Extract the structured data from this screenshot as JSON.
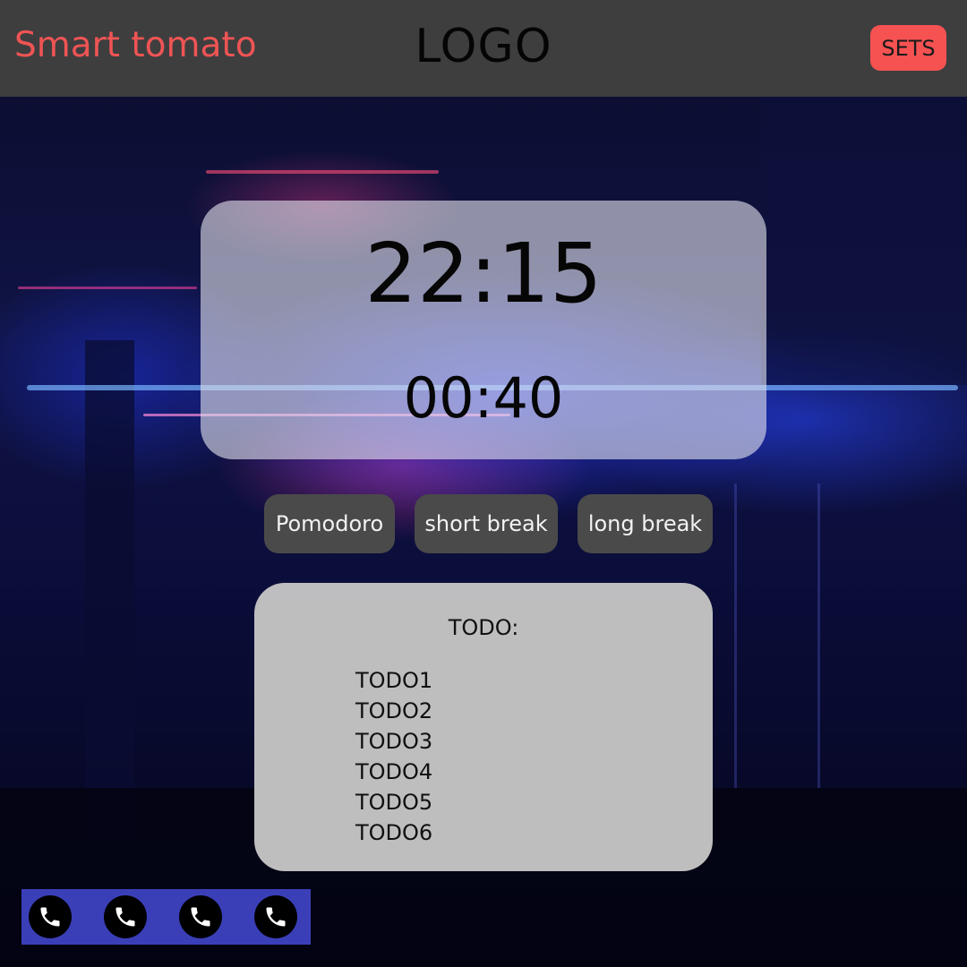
{
  "header": {
    "app_title": "Smart tomato",
    "logo": "LOGO",
    "sets_label": "SETS"
  },
  "timer": {
    "clock": "22:15",
    "countdown": "00:40"
  },
  "modes": [
    {
      "label": "Pomodoro"
    },
    {
      "label": "short break"
    },
    {
      "label": "long break"
    }
  ],
  "todo": {
    "title": "TODO:",
    "items": [
      "TODO1",
      "TODO2",
      "TODO3",
      "TODO4",
      "TODO5",
      "TODO6"
    ]
  },
  "call_bar": {
    "buttons": [
      {
        "icon": "phone-icon"
      },
      {
        "icon": "phone-icon"
      },
      {
        "icon": "phone-icon"
      },
      {
        "icon": "phone-icon"
      }
    ]
  },
  "colors": {
    "header_bg": "#404040",
    "app_title": "#f05454",
    "sets_button": "#f75252",
    "mode_button": "#4a4a4a",
    "todo_panel": "#c4c4c4",
    "call_bar": "#3a3fb8"
  }
}
